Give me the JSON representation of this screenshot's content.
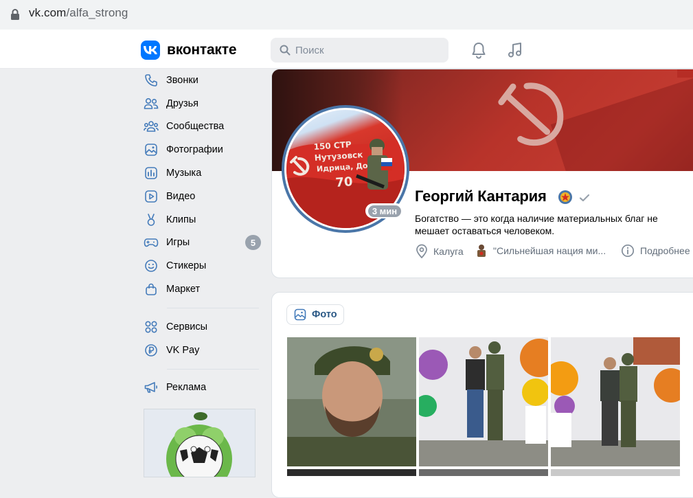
{
  "browser": {
    "url_domain": "vk.com",
    "url_path": "/alfa_strong"
  },
  "header": {
    "logo_text": "вконтакте",
    "search_placeholder": "Поиск"
  },
  "sidebar": {
    "items": [
      {
        "label": "Звонки",
        "icon": "phone-icon"
      },
      {
        "label": "Друзья",
        "icon": "friends-icon"
      },
      {
        "label": "Сообщества",
        "icon": "communities-icon"
      },
      {
        "label": "Фотографии",
        "icon": "photos-icon"
      },
      {
        "label": "Музыка",
        "icon": "music-icon"
      },
      {
        "label": "Видео",
        "icon": "video-icon"
      },
      {
        "label": "Клипы",
        "icon": "clips-icon"
      },
      {
        "label": "Игры",
        "icon": "games-icon",
        "badge": "5"
      },
      {
        "label": "Стикеры",
        "icon": "stickers-icon"
      },
      {
        "label": "Маркет",
        "icon": "market-icon"
      }
    ],
    "secondary": [
      {
        "label": "Сервисы",
        "icon": "services-icon"
      },
      {
        "label": "VK Pay",
        "icon": "vkpay-icon"
      }
    ],
    "tertiary": [
      {
        "label": "Реклама",
        "icon": "ads-icon"
      }
    ]
  },
  "profile": {
    "name": "Георгий Кантария",
    "online": "3 мин",
    "status": "Богатство — это когда наличие материальных благ не мешает оставаться человеком.",
    "city": "Калуга",
    "community": "\"Сильнейшая нация ми...",
    "more": "Подробнее",
    "avatar_banner_text": [
      "150 СТР",
      "Нутузовск",
      "Идрица, Дов",
      "70"
    ]
  },
  "photos": {
    "button_label": "Фото"
  },
  "colors": {
    "accent": "#0077ff",
    "link": "#2a5885",
    "muted": "#818c99",
    "badge": "#99a2ad"
  }
}
